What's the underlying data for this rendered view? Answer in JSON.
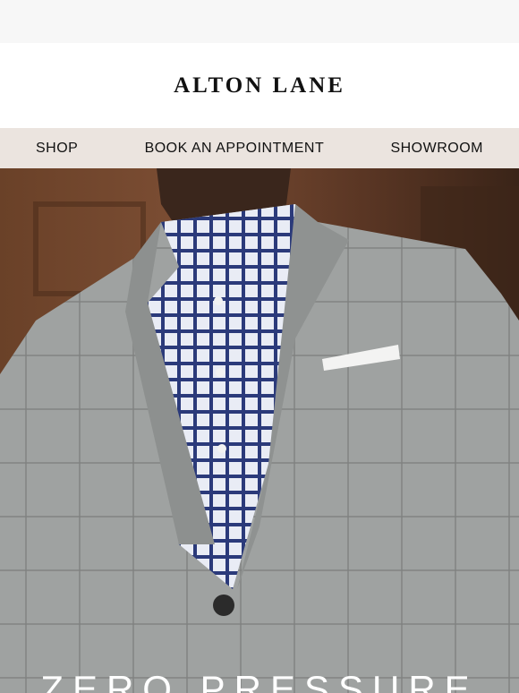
{
  "brand": {
    "name": "ALTON LANE"
  },
  "nav": {
    "items": [
      {
        "label": "SHOP"
      },
      {
        "label": "BOOK AN APPOINTMENT"
      },
      {
        "label": "SHOWROOM"
      }
    ]
  },
  "hero": {
    "headline": "ZERO PRESSURE"
  },
  "colors": {
    "nav_background": "#ebe4df",
    "logo_background": "#ffffff",
    "page_background": "#f7f7f7"
  }
}
